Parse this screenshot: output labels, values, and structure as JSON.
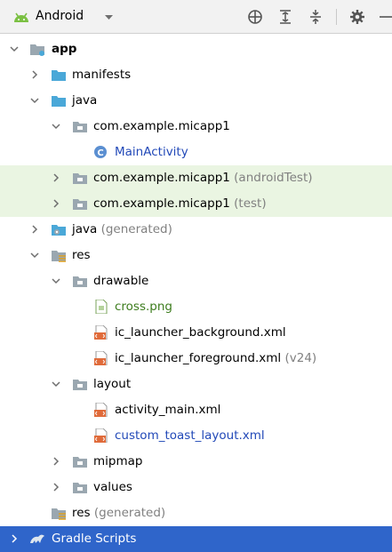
{
  "toolbar": {
    "title": "Android",
    "icons": [
      "android-icon",
      "dropdown-icon",
      "locate-icon",
      "expand-all-icon",
      "collapse-all-icon",
      "gear-icon",
      "hide-icon"
    ]
  },
  "tree": {
    "app": "app",
    "manifests": "manifests",
    "java": "java",
    "pkg_main": "com.example.micapp1",
    "main_activity": "MainActivity",
    "pkg_android_test": "com.example.micapp1",
    "pkg_android_test_suffix": "(androidTest)",
    "pkg_test": "com.example.micapp1",
    "pkg_test_suffix": "(test)",
    "java_generated": "java",
    "java_generated_suffix": "(generated)",
    "res": "res",
    "drawable": "drawable",
    "cross_png": "cross.png",
    "ic_launcher_background": "ic_launcher_background.xml",
    "ic_launcher_foreground": "ic_launcher_foreground.xml",
    "ic_launcher_foreground_suffix": "(v24)",
    "layout": "layout",
    "activity_main": "activity_main.xml",
    "custom_toast_layout": "custom_toast_layout.xml",
    "mipmap": "mipmap",
    "values": "values",
    "res_generated": "res",
    "res_generated_suffix": "(generated)",
    "gradle_scripts": "Gradle Scripts"
  },
  "colors": {
    "selected_row": "#2f65ca",
    "highlight_row": "#eaf5e2",
    "folder_blue": "#4aa8d8",
    "folder_gray": "#9aa7b0",
    "link_blue": "#2249b8",
    "image_green": "#3d7d1e"
  }
}
